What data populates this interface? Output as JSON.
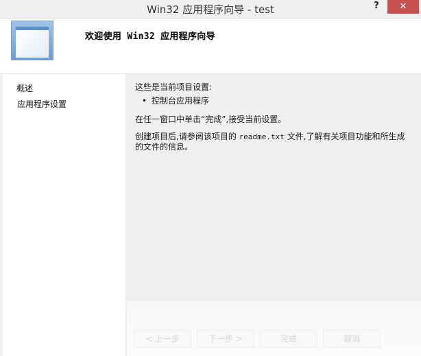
{
  "window": {
    "title": "Win32 应用程序向导 - test",
    "help_label": "?",
    "close_label": "✕"
  },
  "header": {
    "logo_icon": "application-window-icon",
    "title": "欢迎使用 Win32 应用程序向导"
  },
  "sidebar": {
    "items": [
      {
        "label": "概述"
      },
      {
        "label": "应用程序设置"
      }
    ]
  },
  "content": {
    "intro": "这些是当前项目设置:",
    "bullet": "控制台应用程序",
    "finish": "在任一窗口中单击“完成”,接受当前设置。",
    "readme_before": "创建项目后,请参阅该项目的 ",
    "readme_file": "readme.txt",
    "readme_after": " 文件,了解有关项目功能和所生成的文件的信息。"
  },
  "footer": {
    "buttons": [
      {
        "label": "< 上一步"
      },
      {
        "label": "下一步 >"
      },
      {
        "label": "完成"
      },
      {
        "label": "取消"
      }
    ]
  }
}
